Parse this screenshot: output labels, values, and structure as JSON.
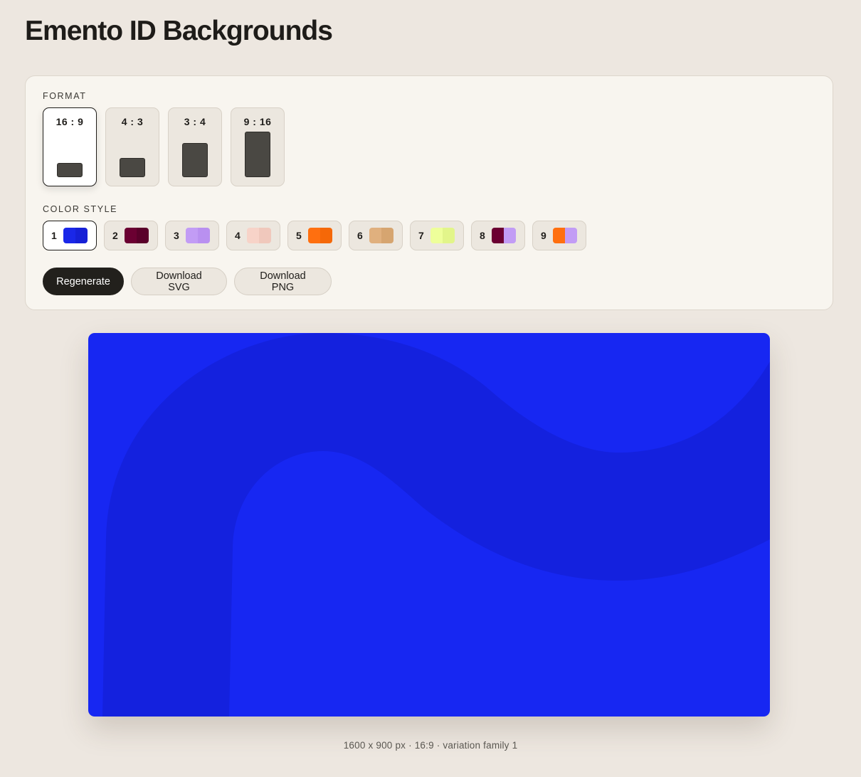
{
  "title": "Emento ID Backgrounds",
  "format": {
    "label": "FORMAT",
    "selected": "16 : 9",
    "options": [
      {
        "label": "16 : 9"
      },
      {
        "label": "4 : 3"
      },
      {
        "label": "3 : 4"
      },
      {
        "label": "9 : 16"
      }
    ]
  },
  "color_style": {
    "label": "COLOR STYLE",
    "selected": "1",
    "options": [
      {
        "label": "1",
        "colors": [
          "#1a27e8",
          "#1620d6"
        ]
      },
      {
        "label": "2",
        "colors": [
          "#6b0032",
          "#5a002a"
        ]
      },
      {
        "label": "3",
        "colors": [
          "#c29cf5",
          "#b990f0"
        ]
      },
      {
        "label": "4",
        "colors": [
          "#f7d3c8",
          "#f0c8bc"
        ]
      },
      {
        "label": "5",
        "colors": [
          "#ff6f0f",
          "#f56808"
        ]
      },
      {
        "label": "6",
        "colors": [
          "#e0b07e",
          "#d6a570"
        ]
      },
      {
        "label": "7",
        "colors": [
          "#eeff9a",
          "#e2f58a"
        ]
      },
      {
        "label": "8",
        "colors": [
          "#6b0032",
          "#c29cf5"
        ]
      },
      {
        "label": "9",
        "colors": [
          "#ff6f0f",
          "#c29cf5"
        ]
      }
    ]
  },
  "actions": {
    "regenerate": "Regenerate",
    "download_svg": "Download SVG",
    "download_png": "Download PNG"
  },
  "preview": {
    "background_color": "#1727f2",
    "band_color": "#1421de"
  },
  "caption": "1600 x 900 px · 16:9 · variation family 1"
}
